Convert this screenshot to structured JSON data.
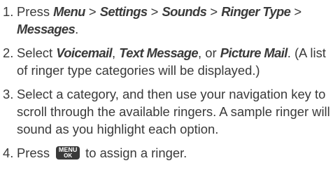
{
  "steps": [
    {
      "number": "1.",
      "parts": [
        {
          "text": "Press ",
          "style": "normal"
        },
        {
          "text": "Menu",
          "style": "em"
        },
        {
          "text": " > ",
          "style": "normal"
        },
        {
          "text": "Settings",
          "style": "em"
        },
        {
          "text": " > ",
          "style": "normal"
        },
        {
          "text": "Sounds",
          "style": "em"
        },
        {
          "text": " > ",
          "style": "normal"
        },
        {
          "text": "Ringer Type",
          "style": "em"
        },
        {
          "text": " > ",
          "style": "normal"
        },
        {
          "text": "Messages",
          "style": "em"
        },
        {
          "text": ".",
          "style": "normal"
        }
      ]
    },
    {
      "number": "2.",
      "parts": [
        {
          "text": "Select ",
          "style": "normal"
        },
        {
          "text": "Voicemail",
          "style": "em"
        },
        {
          "text": ", ",
          "style": "normal"
        },
        {
          "text": "Text Message",
          "style": "em"
        },
        {
          "text": ", or ",
          "style": "normal"
        },
        {
          "text": "Picture Mail",
          "style": "em"
        },
        {
          "text": ". (A list of ringer type categories will be displayed.)",
          "style": "normal"
        }
      ]
    },
    {
      "number": "3.",
      "parts": [
        {
          "text": "Select a category, and then use your navigation key to scroll through the available ringers. A sample ringer will sound as you highlight each option.",
          "style": "normal"
        }
      ]
    },
    {
      "number": "4.",
      "parts": [
        {
          "text": "Press ",
          "style": "normal"
        },
        {
          "key": {
            "top": "MENU",
            "bottom": "OK"
          }
        },
        {
          "text": "to assign a ringer.",
          "style": "normal"
        }
      ]
    }
  ]
}
